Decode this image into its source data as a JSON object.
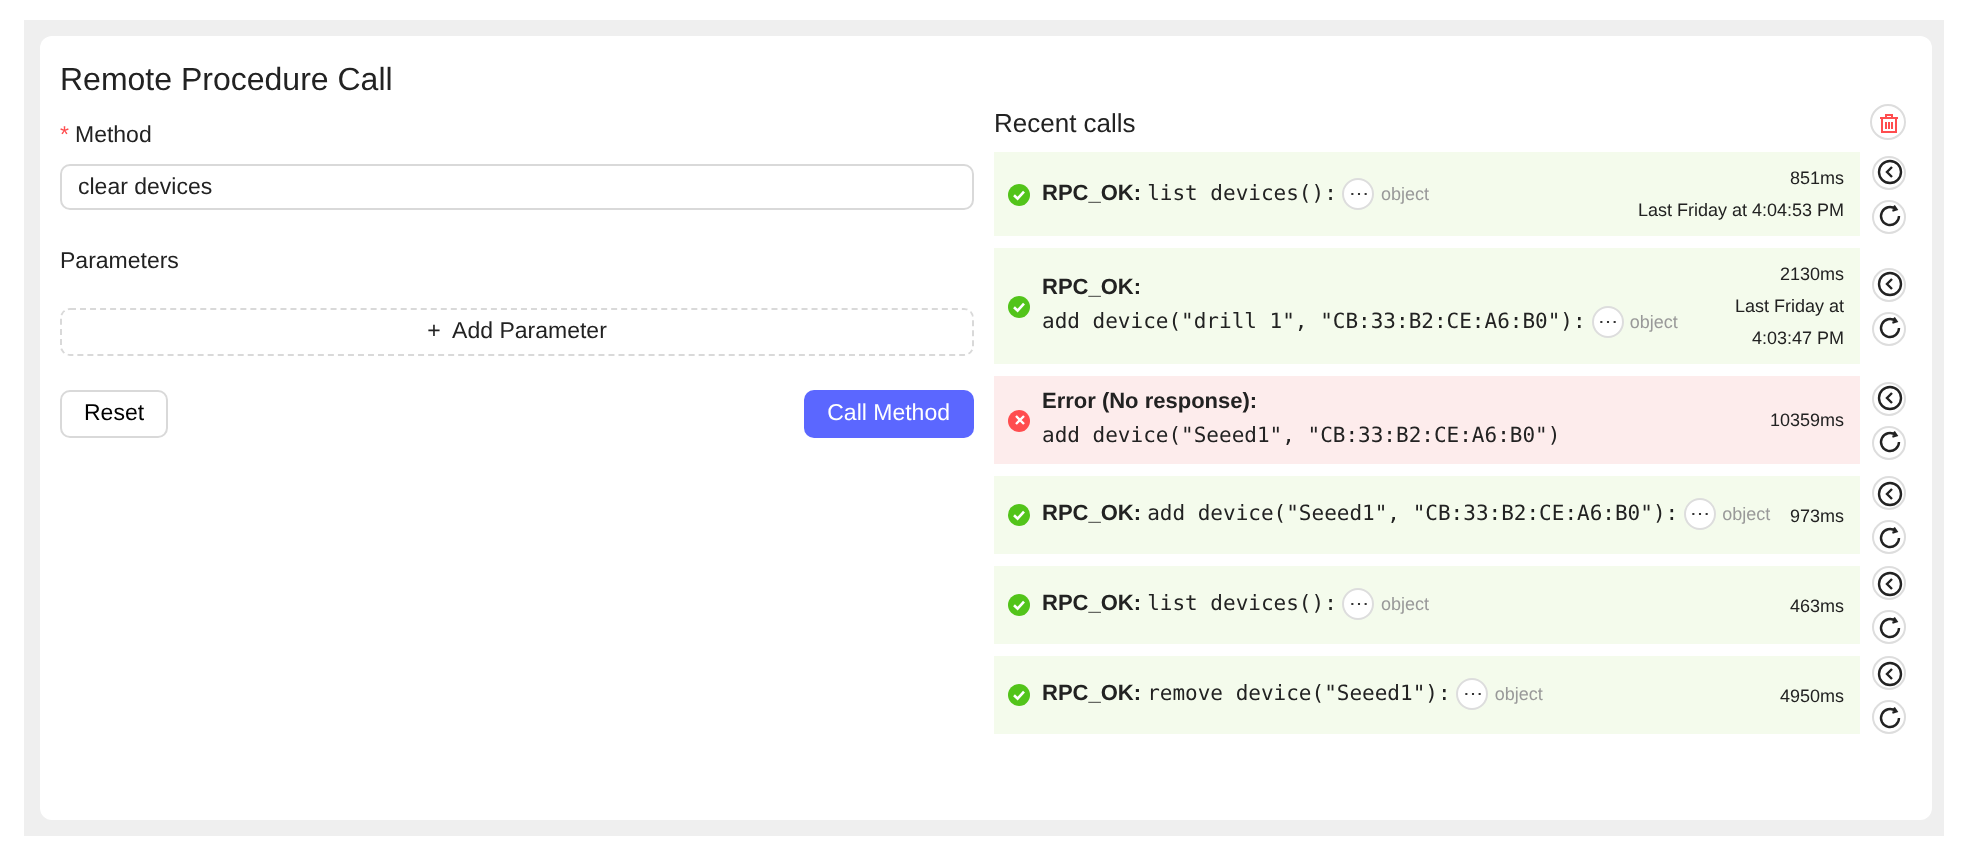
{
  "title": "Remote Procedure Call",
  "method": {
    "required_mark": "*",
    "label": "Method",
    "value": "clear devices"
  },
  "parameters": {
    "label": "Parameters",
    "add_button": {
      "icon": "+",
      "label": "Add Parameter"
    }
  },
  "buttons": {
    "reset": "Reset",
    "call": "Call Method"
  },
  "recent": {
    "title": "Recent calls",
    "calls": [
      {
        "kind": "ok",
        "label": "RPC_OK:",
        "label_break": false,
        "call": "list devices():",
        "result": "object",
        "more": "⋯",
        "duration": "851ms",
        "time": [
          "Last Friday at 4:04:53 PM"
        ]
      },
      {
        "kind": "ok",
        "label": "RPC_OK:",
        "label_break": true,
        "call": "add device(\"drill 1\", \"CB:33:B2:CE:A6:B0\"):",
        "result": "object",
        "more": "⋯",
        "duration": "2130ms",
        "time": [
          "Last Friday at",
          "4:03:47 PM"
        ]
      },
      {
        "kind": "error",
        "label": "Error (No response):",
        "label_break": true,
        "call": "add device(\"Seeed1\", \"CB:33:B2:CE:A6:B0\")",
        "duration": "10359ms"
      },
      {
        "kind": "ok",
        "label": "RPC_OK:",
        "label_break": false,
        "call": "add device(\"Seeed1\", \"CB:33:B2:CE:A6:B0\"):",
        "result": "object",
        "more": "⋯",
        "duration": "973ms"
      },
      {
        "kind": "ok",
        "label": "RPC_OK:",
        "label_break": false,
        "call": "list devices():",
        "result": "object",
        "more": "⋯",
        "duration": "463ms"
      },
      {
        "kind": "ok",
        "label": "RPC_OK:",
        "label_break": false,
        "call": "remove device(\"Seeed1\"):",
        "result": "object",
        "more": "⋯",
        "duration": "4950ms"
      }
    ]
  }
}
